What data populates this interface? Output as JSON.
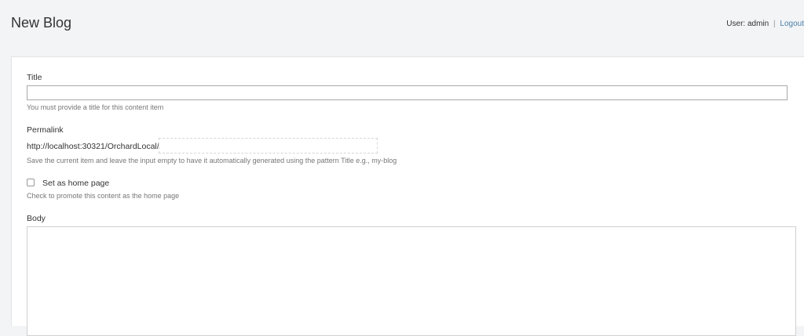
{
  "header": {
    "title": "New Blog",
    "user_prefix": "User:",
    "user_name": "admin",
    "separator": "|",
    "logout_label": "Logout"
  },
  "form": {
    "title": {
      "label": "Title",
      "value": "",
      "hint": "You must provide a title for this content item"
    },
    "permalink": {
      "label": "Permalink",
      "prefix": "http://localhost:30321/OrchardLocal/",
      "value": "",
      "hint": "Save the current item and leave the input empty to have it automatically generated using the pattern Title e.g., my-blog"
    },
    "home_page": {
      "label": "Set as home page",
      "checked": false,
      "hint": "Check to promote this content as the home page"
    },
    "body": {
      "label": "Body",
      "value": ""
    }
  }
}
